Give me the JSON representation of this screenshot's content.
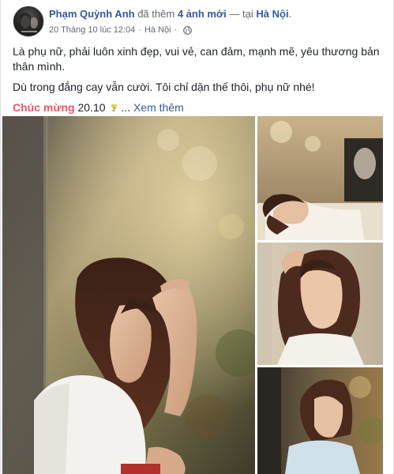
{
  "post": {
    "author": "Phạm Quỳnh Anh",
    "action_prefix": "đã thêm",
    "action_count": "4 ảnh mới",
    "action_sep": "— tại",
    "location": "Hà Nội",
    "timestamp": "20 Tháng 10 lúc 12:04",
    "place": "Hà Nội",
    "privacy_icon": "globe-icon",
    "text_line1": "Là phụ nữ, phải luôn xinh đẹp, vui vẻ, can đảm, mạnh mẽ, yêu thương bản thân mình.",
    "text_line2": "Dù trong đắng cay vẫn cười. Tôi chỉ dặn thế thôi, phụ nữ nhé!",
    "hashtag": "Chúc mừng",
    "hashtag_suffix": "20.10",
    "see_more_prefix": "...",
    "see_more": "Xem thêm"
  },
  "colors": {
    "link": "#365899",
    "hashtag": "#f35369",
    "meta": "#616770",
    "text": "#1d2129"
  },
  "photos": [
    {
      "name": "photo-1"
    },
    {
      "name": "photo-2"
    },
    {
      "name": "photo-3"
    },
    {
      "name": "photo-4"
    }
  ]
}
